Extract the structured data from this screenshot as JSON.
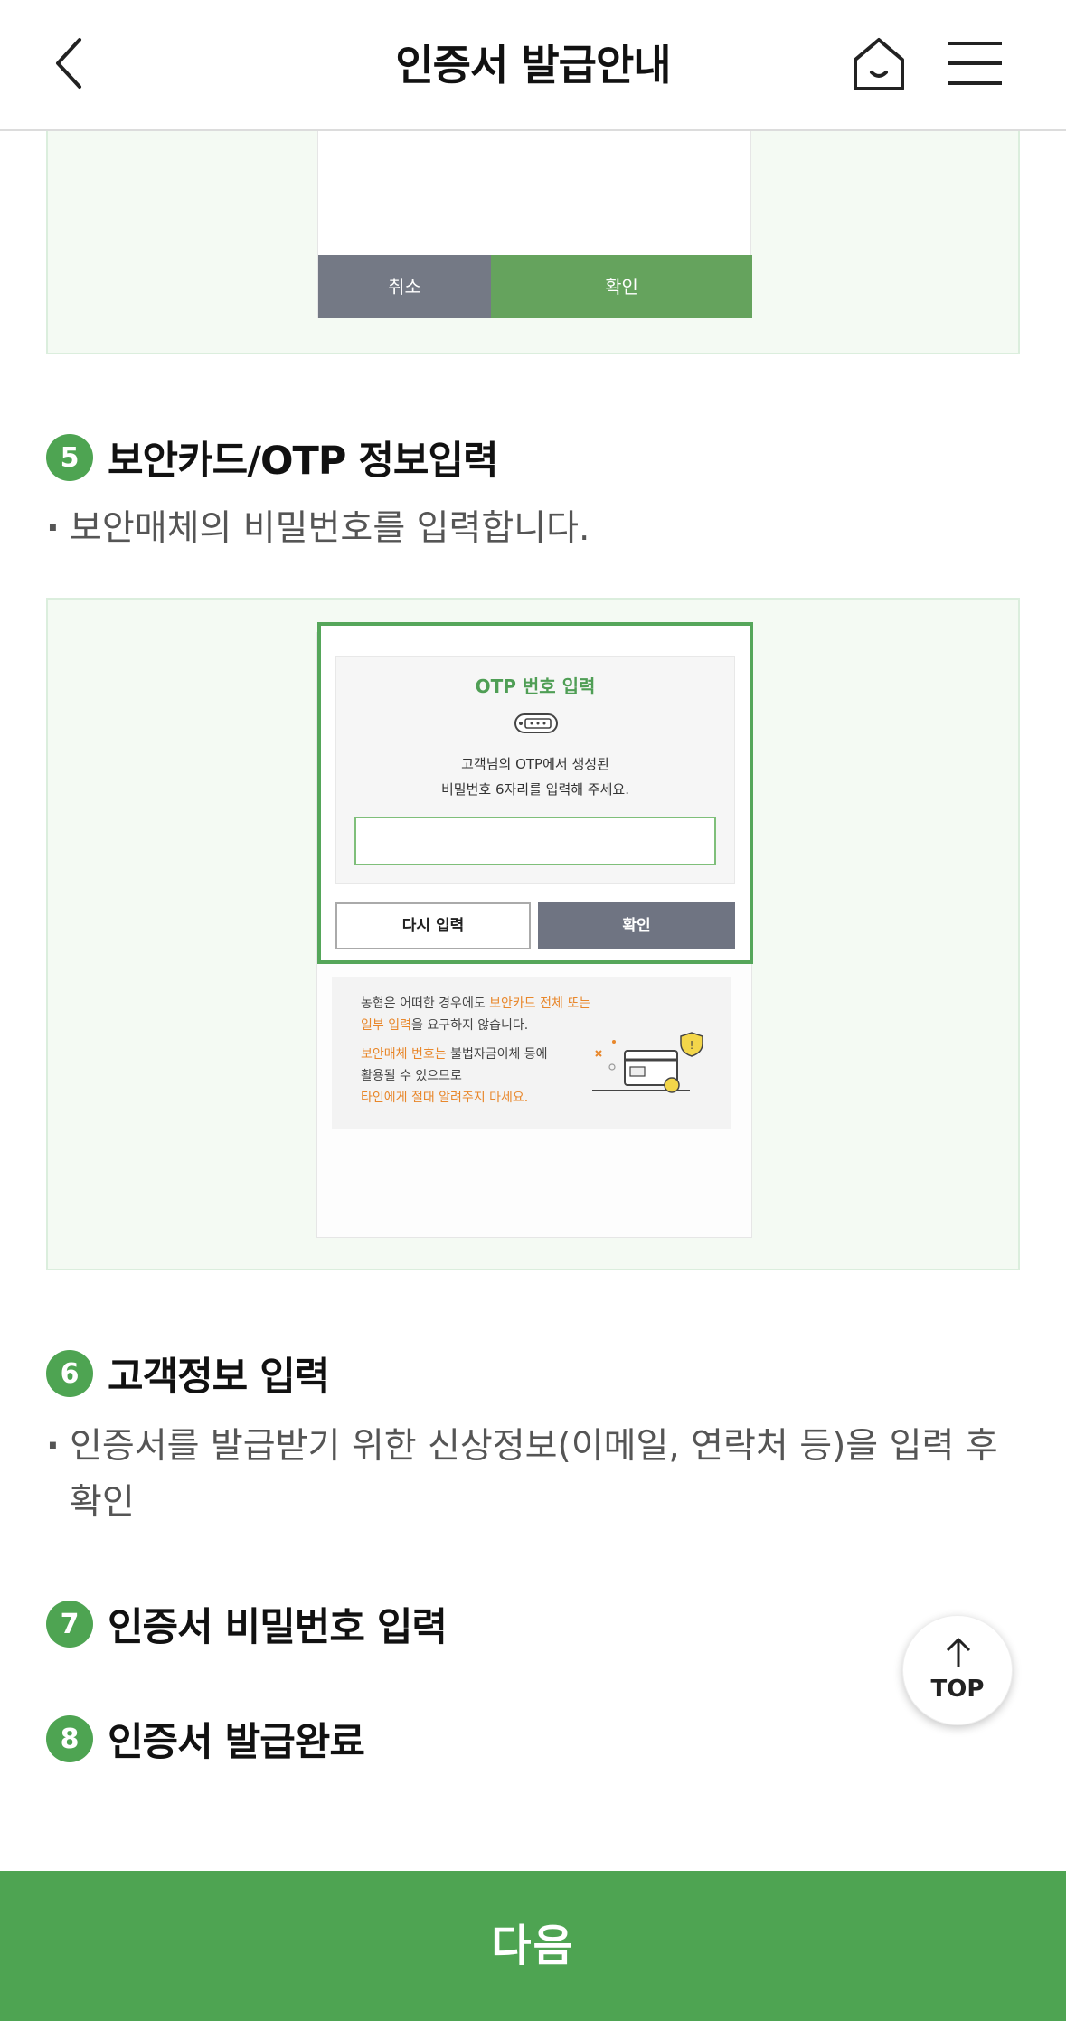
{
  "header": {
    "title": "인증서 발급안내",
    "back_icon": "chevron-left-icon",
    "home_icon": "home-icon",
    "menu_icon": "hamburger-menu-icon"
  },
  "illustration_top": {
    "cancel_label": "취소",
    "confirm_label": "확인"
  },
  "steps": [
    {
      "num": "5",
      "title": "보안카드/OTP 정보입력",
      "desc": "보안매체의 비밀번호를 입력합니다."
    },
    {
      "num": "6",
      "title": "고객정보 입력",
      "desc": "인증서를 발급받기 위한 신상정보(이메일, 연락처 등)을 입력 후 확인"
    },
    {
      "num": "7",
      "title": "인증서 비밀번호 입력"
    },
    {
      "num": "8",
      "title": "인증서 발급완료"
    }
  ],
  "otp_illustration": {
    "title": "OTP 번호 입력",
    "text_line1": "고객님의 OTP에서 생성된",
    "text_line2": "비밀번호 6자리를 입력해 주세요.",
    "retry_label": "다시 입력",
    "confirm_label": "확인",
    "notice_1a": "농협은 어떠한 경우에도 ",
    "notice_1b": "보안카드 전체 또는",
    "notice_1c": "일부 입력",
    "notice_1d": "을 요구하지 않습니다.",
    "notice_2a": "보안매체 번호는",
    "notice_2b": " 불법자금이체 등에",
    "notice_2c": "활용될 수 있으므로",
    "notice_2d": "타인에게 절대 알려주지 마세요."
  },
  "top_button": {
    "label": "TOP"
  },
  "next_button": {
    "label": "다음"
  },
  "colors": {
    "brand_green": "#4ea452",
    "notice_orange": "#e8872b"
  }
}
